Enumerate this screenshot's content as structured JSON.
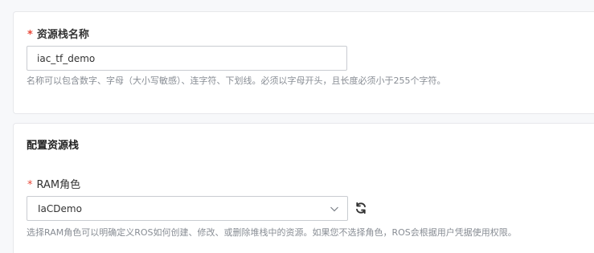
{
  "stack_name": {
    "required_mark": "*",
    "label": "资源栈名称",
    "value": "iac_tf_demo",
    "help": "名称可以包含数字、字母（大小写敏感）、连字符、下划线。必须以字母开头，且长度必须小于255个字符。"
  },
  "config": {
    "title": "配置资源栈",
    "ram_role": {
      "required_mark": "*",
      "label": "RAM角色",
      "selected": "IaCDemo",
      "help": "选择RAM角色可以明确定义ROS如何创建、修改、或删除堆栈中的资源。如果您不选择角色，ROS会根据用户凭据使用权限。"
    }
  },
  "icons": {
    "select_chevron": "chevron-down-icon",
    "refresh": "refresh-icon"
  },
  "colors": {
    "required": "#e84738",
    "help_text": "#888d94",
    "border": "#c9ccd1"
  }
}
